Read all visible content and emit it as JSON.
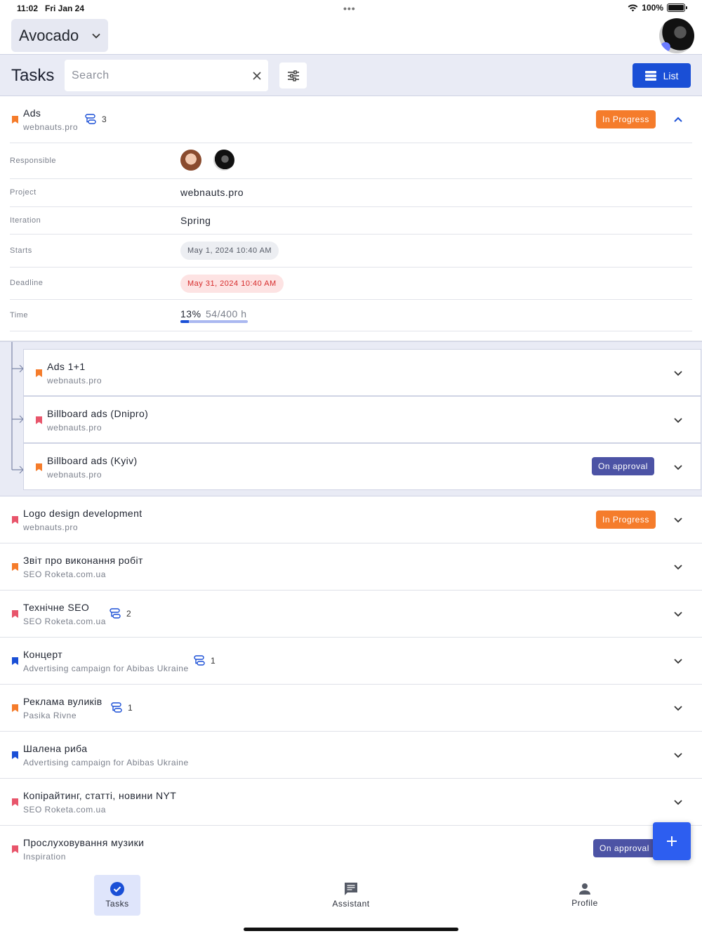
{
  "status_bar": {
    "time": "11:02",
    "date": "Fri Jan 24",
    "battery": "100%"
  },
  "workspace": {
    "name": "Avocado"
  },
  "toolbar": {
    "title": "Tasks",
    "search_placeholder": "Search",
    "view_label": "List"
  },
  "expanded_task": {
    "title": "Ads",
    "project": "webnauts.pro",
    "subtask_count": "3",
    "status": "In Progress",
    "status_color": "#f57c2b",
    "details": {
      "responsible_label": "Responsible",
      "project_label": "Project",
      "project_value": "webnauts.pro",
      "iteration_label": "Iteration",
      "iteration_value": "Spring",
      "starts_label": "Starts",
      "starts_value": "May 1, 2024 10:40 AM",
      "deadline_label": "Deadline",
      "deadline_value": "May 31, 2024 10:40 AM",
      "time_label": "Time",
      "time_percent": "13%",
      "time_value": "54/400 h",
      "time_progress": 0.13
    },
    "subtasks": [
      {
        "title": "Ads 1+1",
        "project": "webnauts.pro",
        "flag_color": "#f57c2b"
      },
      {
        "title": "Billboard ads (Dnipro)",
        "project": "webnauts.pro",
        "flag_color": "#e8556b"
      },
      {
        "title": "Billboard ads (Kyiv)",
        "project": "webnauts.pro",
        "flag_color": "#f57c2b",
        "status": "On approval"
      }
    ]
  },
  "tasks": [
    {
      "title": "Logo design development",
      "project": "webnauts.pro",
      "flag_color": "#e8556b",
      "status": "In Progress"
    },
    {
      "title": "Звіт про виконання робіт",
      "project": "SEO Roketa.com.ua",
      "flag_color": "#f57c2b"
    },
    {
      "title": "Технічне SEO",
      "project": "SEO Roketa.com.ua",
      "flag_color": "#e8556b",
      "subtask_count": "2"
    },
    {
      "title": "Концерт",
      "project": "Advertising campaign for Abibas Ukraine",
      "flag_color": "#1a4fd6",
      "subtask_count": "1"
    },
    {
      "title": "Реклама вуликів",
      "project": "Pasika Rivne",
      "flag_color": "#f57c2b",
      "subtask_count": "1"
    },
    {
      "title": "Шалена риба",
      "project": "Advertising campaign for Abibas Ukraine",
      "flag_color": "#1a4fd6"
    },
    {
      "title": "Копірайтинг, статті, новини NYT",
      "project": "SEO Roketa.com.ua",
      "flag_color": "#e8556b"
    },
    {
      "title": "Прослуховування музики",
      "project": "Inspiration",
      "flag_color": "#e8556b",
      "status": "On approval"
    }
  ],
  "bottom_nav": {
    "tasks": "Tasks",
    "assistant": "Assistant",
    "profile": "Profile"
  },
  "colors": {
    "accent": "#1a4fd6",
    "in_progress": "#f57c2b",
    "on_approval": "#4c53a5"
  }
}
